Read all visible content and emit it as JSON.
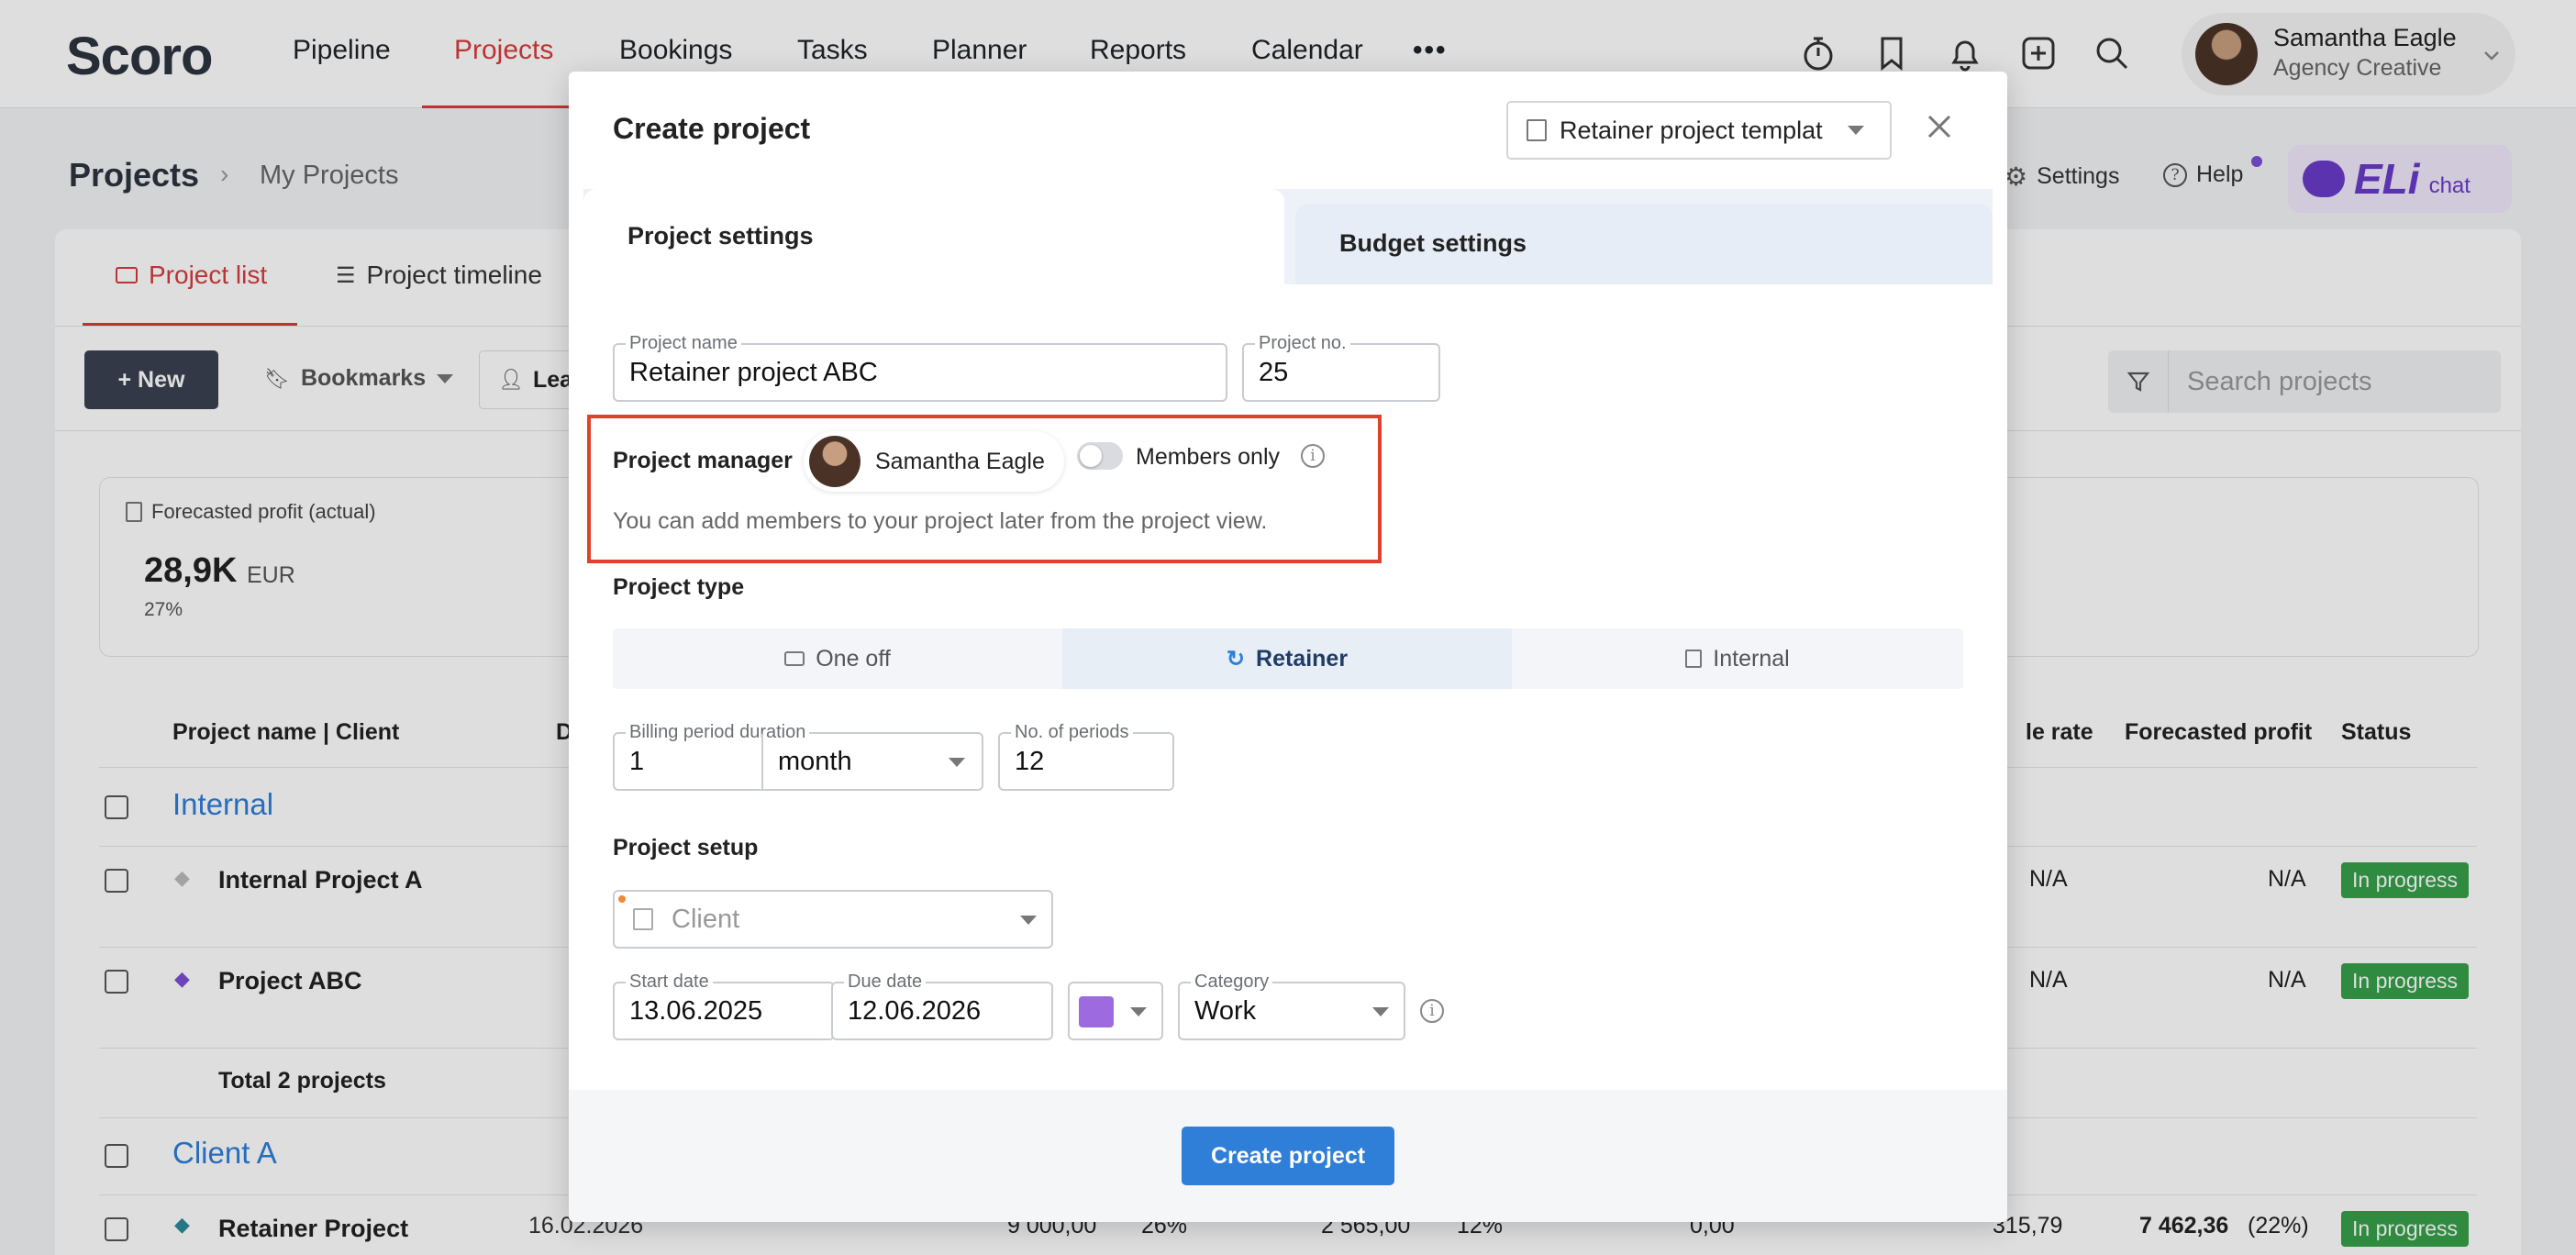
{
  "app": {
    "logo": "Scoro"
  },
  "topnav": {
    "items": [
      "Pipeline",
      "Projects",
      "Bookings",
      "Tasks",
      "Planner",
      "Reports",
      "Calendar"
    ],
    "active": "Projects",
    "more": "•••",
    "user": {
      "name": "Samantha Eagle",
      "role": "Agency Creative"
    }
  },
  "page": {
    "breadcrumb_title": "Projects",
    "breadcrumb_sub": "My Projects",
    "settings": "Settings",
    "help": "Help",
    "eli_logo": "ELi",
    "eli_chat": "chat",
    "tabs": [
      "Project list",
      "Project timeline"
    ],
    "new_button": "+ New",
    "bookmarks": "Bookmarks",
    "lead_filter": "Lea",
    "search_placeholder": "Search projects",
    "kpi": {
      "label": "Forecasted profit (actual)",
      "value": "28,9K",
      "unit": "EUR",
      "pct": "27%"
    },
    "table": {
      "headers": [
        "Project name | Client",
        "D",
        "le rate",
        "Forecasted profit",
        "Status"
      ],
      "groups": [
        {
          "name": "Internal",
          "rows": [
            {
              "name": "Internal Project A",
              "rate": "N/A",
              "profit": "N/A",
              "status": "In progress"
            },
            {
              "name": "Project ABC",
              "rate": "N/A",
              "profit": "N/A",
              "status": "In progress"
            }
          ],
          "total": "Total 2 projects"
        },
        {
          "name": "Client A",
          "rows": [
            {
              "name": "Retainer Project",
              "date": "16.02.2026",
              "budget": "9 000,00",
              "budget_pct": "26%",
              "cost": "2 565,00",
              "cost_pct": "12%",
              "extra": "0,00",
              "rate": "315,79",
              "profit": "7 462,36",
              "profit_pct": "(22%)",
              "status": "In progress"
            }
          ]
        }
      ]
    }
  },
  "modal": {
    "title": "Create project",
    "template_select": "Retainer project templat",
    "tabs": [
      "Project settings",
      "Budget settings"
    ],
    "project_name": {
      "label": "Project name",
      "value": "Retainer project ABC"
    },
    "project_no": {
      "label": "Project no.",
      "value": "25"
    },
    "manager": {
      "label": "Project manager",
      "name": "Samantha Eagle",
      "members_only": "Members only",
      "hint": "You can add members to your project later from the project view."
    },
    "project_type": {
      "label": "Project type",
      "options": [
        "One off",
        "Retainer",
        "Internal"
      ],
      "selected": "Retainer"
    },
    "billing": {
      "label": "Billing period duration",
      "value": "1",
      "unit": "month",
      "periods_label": "No. of periods",
      "periods": "12"
    },
    "setup": {
      "label": "Project setup",
      "client_placeholder": "Client"
    },
    "start_date": {
      "label": "Start date",
      "value": "13.06.2025"
    },
    "due_date": {
      "label": "Due date",
      "value": "12.06.2026"
    },
    "color": "#9d6bdf",
    "category": {
      "label": "Category",
      "value": "Work"
    },
    "submit": "Create project"
  },
  "colors": {
    "accent": "#d73c3c",
    "primary_button": "#2f7ed8",
    "highlight_box": "#e0412c",
    "status_green": "#37a04a",
    "link_blue": "#2f7ed8"
  }
}
